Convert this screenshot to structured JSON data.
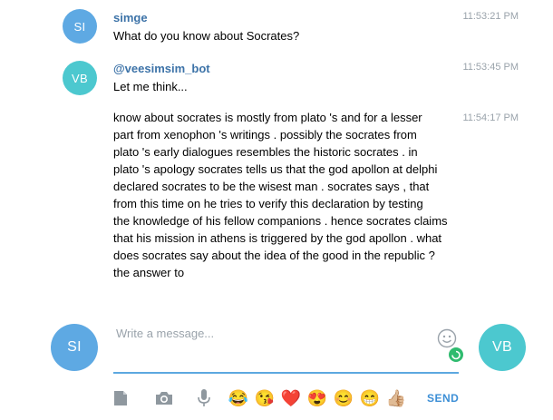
{
  "messages": [
    {
      "avatar_initials": "SI",
      "sender": "simge",
      "time": "11:53:21 PM",
      "text": "What do you know about Socrates?"
    },
    {
      "avatar_initials": "VB",
      "sender": "@veesimsim_bot",
      "time": "11:53:45 PM",
      "text": "Let me think..."
    },
    {
      "time": "11:54:17 PM",
      "lines": [
        "know about socrates is mostly from plato 's and for a lesser",
        "part from xenophon 's writings . possibly the socrates from",
        "plato 's early dialogues resembles the historic socrates . in",
        "plato 's apology socrates tells us that the god apollon at delphi",
        "declared socrates to be the wisest man . socrates says , that",
        "from this time on he tries to verify this declaration by testing",
        "the knowledge of his fellow companions . hence socrates claims",
        "that his mission in athens is triggered by the god apollon . what",
        "does socrates say about the idea of the good in the republic ?",
        "the answer to"
      ]
    }
  ],
  "composer": {
    "self_avatar": "SI",
    "peer_avatar": "VB",
    "placeholder": "Write a message...",
    "send_label": "SEND",
    "emojis": [
      "😂",
      "😘",
      "❤️",
      "😍",
      "😊",
      "😁",
      "👍🏼"
    ],
    "tools": [
      "file-icon",
      "camera-icon",
      "microphone-icon"
    ]
  },
  "colors": {
    "avatar_si": "#5ea9e3",
    "avatar_vb": "#4cc8cf",
    "sender_name": "#3d73a8",
    "accent_line": "#5da8e0",
    "send": "#3d8fd6"
  }
}
